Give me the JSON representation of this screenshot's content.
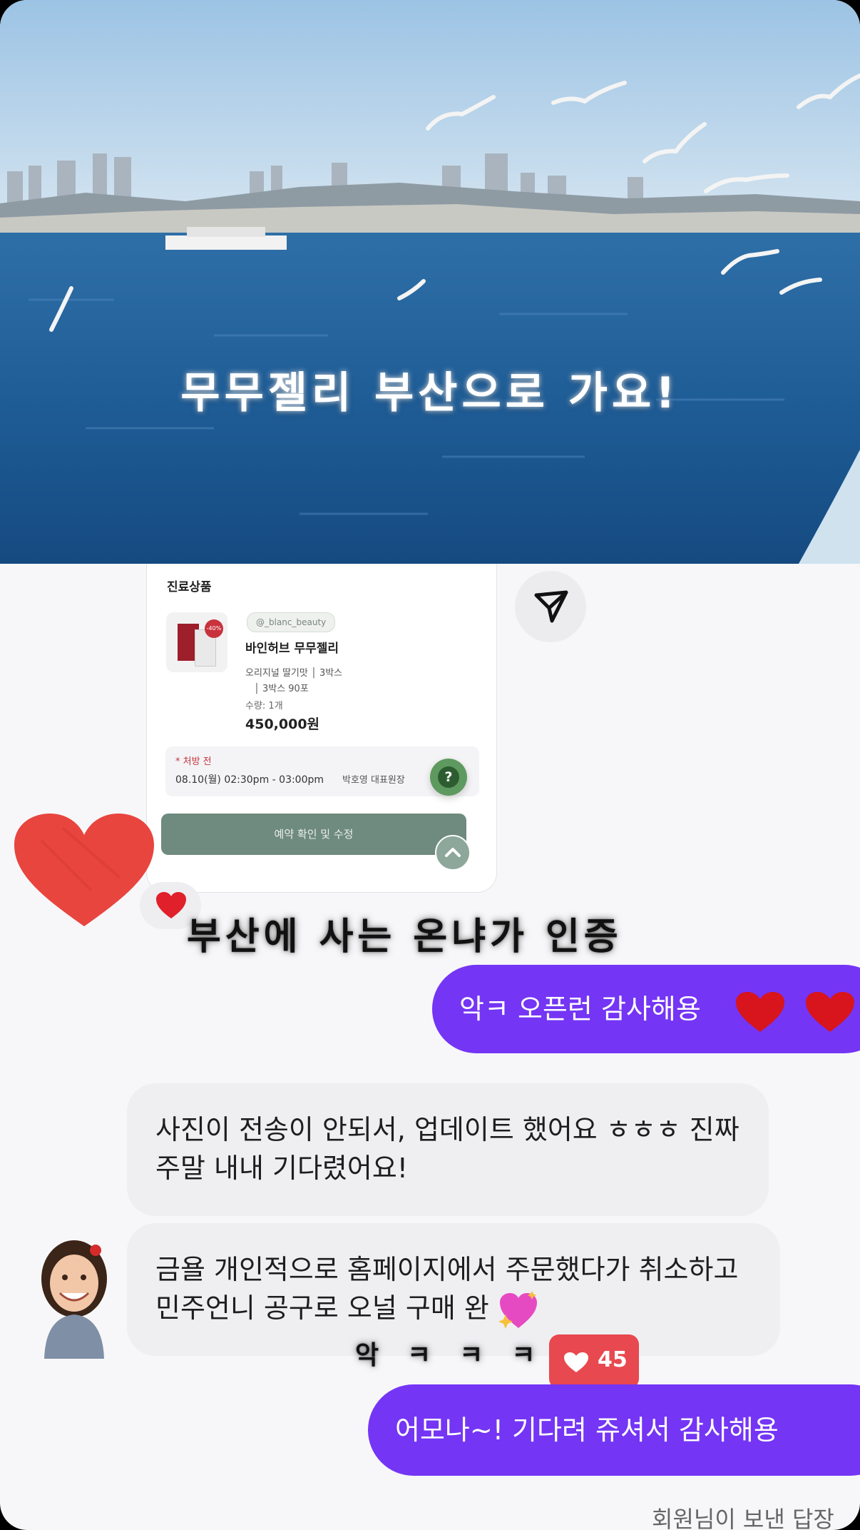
{
  "hero": {
    "title": "무무젤리 부산으로 가요!"
  },
  "order_card": {
    "section_title": "진료상품",
    "seller_tag": "@_blanc_beauty",
    "sale_badge": "-40%",
    "product_name": "바인허브 무무젤리",
    "option_line1": "오리지널 딸기맛 │ 3박스",
    "option_line2": "│ 3박스 90포",
    "quantity": "수량: 1개",
    "price": "450,000원",
    "status": "* 처방 전",
    "schedule": "08.10(월) 02:30pm - 03:00pm",
    "doctor": "박호영 대표원장",
    "confirm_button": "예약 확인 및 수정",
    "help_icon": "question-icon"
  },
  "side_actions": {
    "send_icon": "send-icon"
  },
  "stickers": {
    "caption1": "부산에 사는 온냐가 인증",
    "caption2": "악ㅋㅋㅋ"
  },
  "messages": [
    {
      "direction": "outgoing",
      "text": "악ㅋ 오픈런 감사해용"
    },
    {
      "direction": "incoming",
      "text": "사진이 전송이 안되서, 업데이트 했어요 ㅎㅎㅎ 진짜 주말 내내 기다렸어요!"
    },
    {
      "direction": "incoming",
      "text": "금욜 개인적으로 홈페이지에서 주문했다가 취소하고 민주언니 공구로 오널 구매 완"
    },
    {
      "direction": "outgoing",
      "text": "어모나~! 기다려 쥬셔서 감사해용"
    }
  ],
  "like_badge": {
    "count": "45"
  },
  "footer_note": "회원님이 보낸 답장",
  "colors": {
    "outgoing_bubble": "#7435f5",
    "incoming_bubble": "#efeff2",
    "like_badge": "#e8484f",
    "confirm_button": "#6f8a7e"
  }
}
